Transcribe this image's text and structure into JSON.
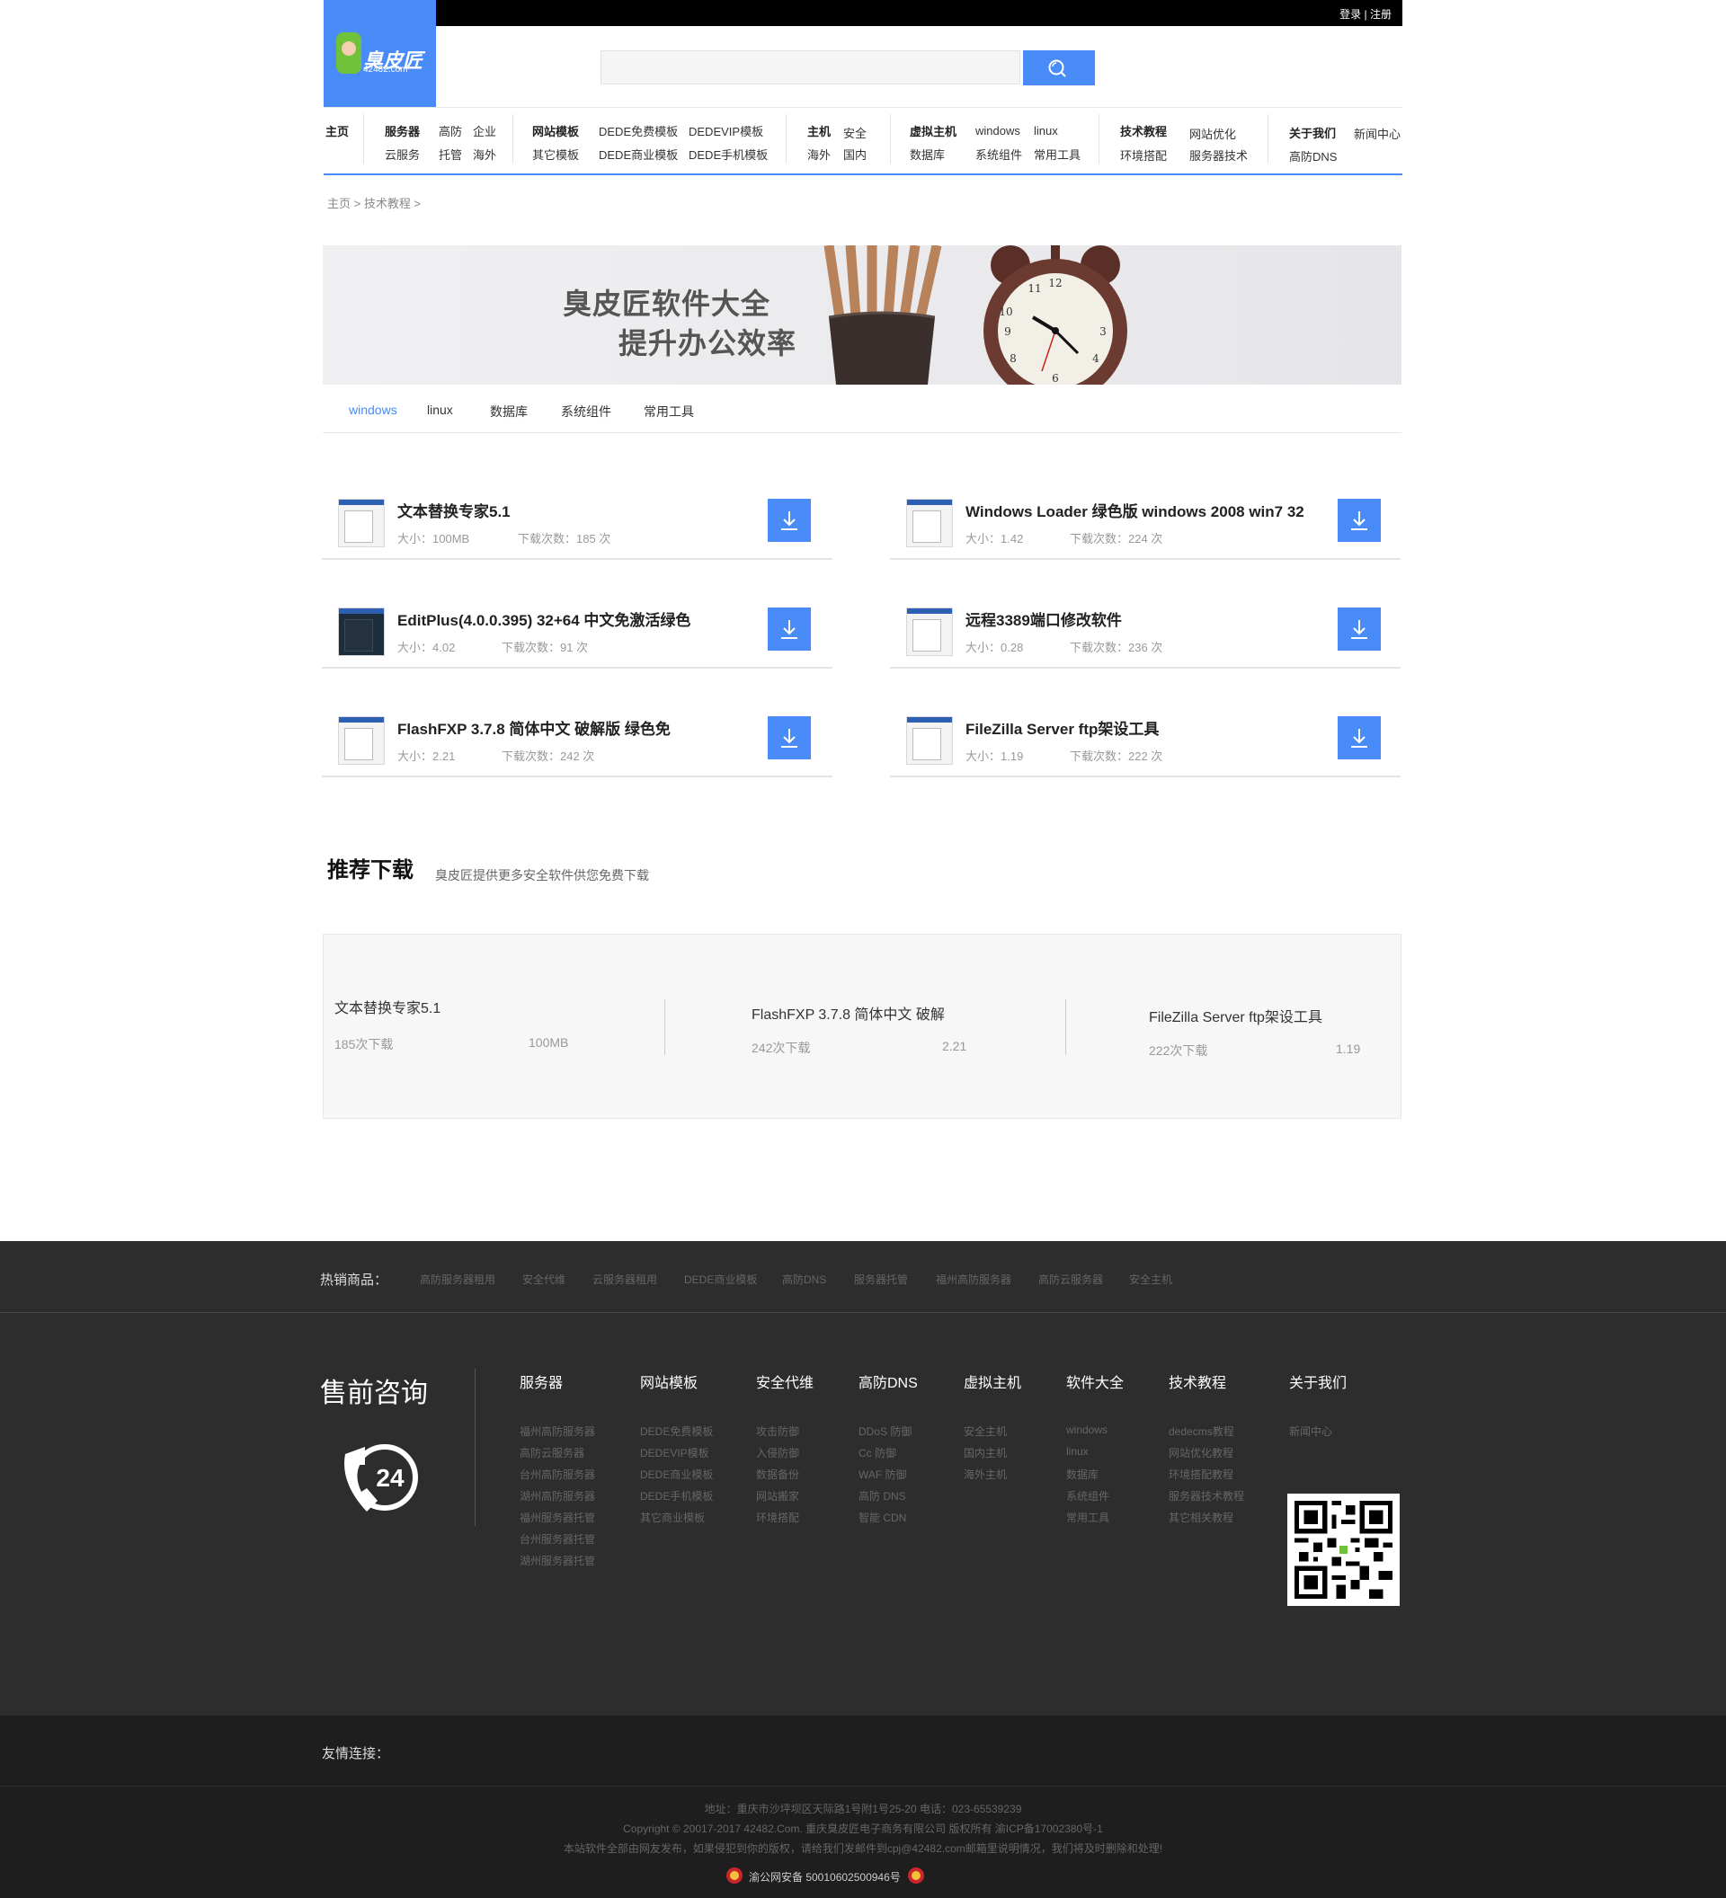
{
  "header": {
    "login": "登录",
    "separator": "|",
    "register": "注册",
    "logo_name": "臭皮匠",
    "logo_domain": "42482.com"
  },
  "nav": {
    "home": "主页",
    "groups": [
      {
        "title": "服务器",
        "row1": [
          "高防",
          "企业"
        ],
        "row2": [
          "云服务",
          "托管",
          "海外"
        ]
      },
      {
        "title": "网站模板",
        "row1": [
          "DEDE免费模板",
          "DEDEVIP模板"
        ],
        "row2": [
          "其它模板",
          "DEDE商业模板",
          "DEDE手机模板"
        ]
      },
      {
        "title": "主机",
        "row1": [
          "安全"
        ],
        "row2": [
          "海外",
          "国内"
        ]
      },
      {
        "title": "虚拟主机",
        "row1": [
          "windows",
          "linux"
        ],
        "row2": [
          "数据库",
          "系统组件",
          "常用工具"
        ]
      },
      {
        "title": "技术教程",
        "row1": [
          "网站优化"
        ],
        "row2": [
          "环境搭配",
          "服务器技术"
        ]
      },
      {
        "title": "关于我们",
        "row1": [
          "新闻中心"
        ],
        "row2": [
          "高防DNS"
        ]
      }
    ]
  },
  "breadcrumb": "主页 > 技术教程 >",
  "banner": {
    "line1": "臭皮匠软件大全",
    "line2": "提升办公效率"
  },
  "tabs": [
    "windows",
    "linux",
    "数据库",
    "系统组件",
    "常用工具"
  ],
  "items": [
    {
      "title": "文本替换专家5.1",
      "size": "大小：100MB",
      "downloads": "下载次数：185  次"
    },
    {
      "title": "Windows Loader 绿色版 windows 2008 win7 32",
      "size": "大小：1.42",
      "downloads": "下载次数：224  次"
    },
    {
      "title": "EditPlus(4.0.0.395) 32+64 中文免激活绿色",
      "size": "大小：4.02",
      "downloads": "下载次数：91  次"
    },
    {
      "title": "远程3389端口修改软件",
      "size": "大小：0.28",
      "downloads": "下载次数：236  次"
    },
    {
      "title": "FlashFXP 3.7.8 简体中文 破解版 绿色免",
      "size": "大小：2.21",
      "downloads": "下载次数：242  次"
    },
    {
      "title": "FileZilla Server ftp架设工具",
      "size": "大小：1.19",
      "downloads": "下载次数：222  次"
    }
  ],
  "recommend": {
    "title": "推荐下载",
    "subtitle": "臭皮匠提供更多安全软件供您免费下载",
    "items": [
      {
        "name": "文本替换专家5.1",
        "count": "185次下载",
        "size": "100MB"
      },
      {
        "name": "FlashFXP 3.7.8 简体中文 破解",
        "count": "242次下载",
        "size": "2.21"
      },
      {
        "name": "FileZilla Server ftp架设工具",
        "count": "222次下载",
        "size": "1.19"
      }
    ]
  },
  "footer": {
    "hot_label": "热销商品：",
    "hot_items": [
      "高防服务器租用",
      "安全代维",
      "云服务器租用",
      "DEDE商业模板",
      "高防DNS",
      "服务器托管",
      "福州高防服务器",
      "高防云服务器",
      "安全主机"
    ],
    "presale": "售前咨询",
    "columns": [
      {
        "title": "服务器",
        "items": [
          "福州高防服务器",
          "高防云服务器",
          "台州高防服务器",
          "湖州高防服务器",
          "福州服务器托管",
          "台州服务器托管",
          "湖州服务器托管"
        ]
      },
      {
        "title": "网站模板",
        "items": [
          "DEDE免费模板",
          "DEDEVIP模板",
          "DEDE商业模板",
          "DEDE手机模板",
          "其它商业模板"
        ]
      },
      {
        "title": "安全代维",
        "items": [
          "攻击防御",
          "入侵防御",
          "数据备份",
          "网站搬家",
          "环境搭配"
        ]
      },
      {
        "title": "高防DNS",
        "items": [
          "DDoS 防御",
          "Cc 防御",
          "WAF 防御",
          "高防 DNS",
          "智能 CDN"
        ]
      },
      {
        "title": "虚拟主机",
        "items": [
          "安全主机",
          "国内主机",
          "海外主机"
        ]
      },
      {
        "title": "软件大全",
        "items": [
          "windows",
          "linux",
          "数据库",
          "系统组件",
          "常用工具"
        ]
      },
      {
        "title": "技术教程",
        "items": [
          "dedecms教程",
          "网站优化教程",
          "环境搭配教程",
          "服务器技术教程",
          "其它相关教程"
        ]
      },
      {
        "title": "关于我们",
        "items": [
          "新闻中心"
        ]
      }
    ],
    "friend": "友情连接：",
    "address": "地址：重庆市沙坪坝区天际路1号附1号25-20   电话：023-65539239",
    "copyright": "Copyright © 20017-2017 42482.Com. 重庆臭皮匠电子商务有限公司 版权所有  渝ICP备17002380号-1",
    "notice": "本站软件全部由网友发布，如果侵犯到你的版权，请给我们发邮件到cpj@42482.com邮箱里说明情况，我们将及时删除和处理!",
    "beian": "渝公网安备 50010602500946号"
  }
}
